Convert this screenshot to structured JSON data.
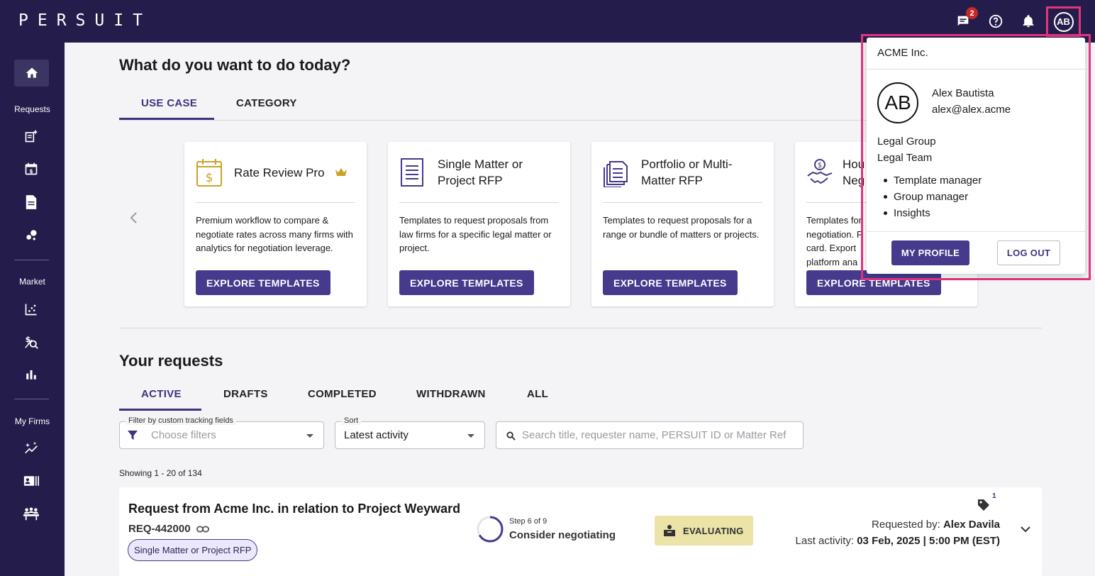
{
  "app": {
    "logo": "PERSUIT"
  },
  "topbar": {
    "messages_badge": "2",
    "avatar_initials": "AB"
  },
  "sidebar": {
    "section_requests": "Requests",
    "section_market": "Market",
    "section_my_firms": "My Firms"
  },
  "page": {
    "title": "What do you want to do today?",
    "tabs": [
      {
        "label": "USE CASE",
        "active": true
      },
      {
        "label": "CATEGORY",
        "active": false
      }
    ]
  },
  "cards": [
    {
      "title": "Rate Review Pro",
      "icon": "calendar-dollar-icon",
      "premium": true,
      "description": "Premium workflow to compare & negotiate rates across many firms with analytics for negotiation leverage.",
      "button": "EXPLORE TEMPLATES"
    },
    {
      "title": "Single Matter or Project RFP",
      "icon": "document-icon",
      "description": "Templates to request proposals from law firms for a specific legal matter or project.",
      "button": "EXPLORE TEMPLATES"
    },
    {
      "title": "Portfolio or Multi-Matter RFP",
      "icon": "folders-icon",
      "description": "Templates to request proposals for a range or bundle of matters or projects.",
      "button": "EXPLORE TEMPLATES"
    },
    {
      "title": "Hou Neg",
      "icon": "handshake-dollar-icon",
      "description": "Templates for negotiation. F card. Export platform ana",
      "button": "EXPLORE TEMPLATES"
    }
  ],
  "requests": {
    "title": "Your requests",
    "tabs": [
      {
        "label": "ACTIVE",
        "active": true
      },
      {
        "label": "DRAFTS",
        "active": false
      },
      {
        "label": "COMPLETED",
        "active": false
      },
      {
        "label": "WITHDRAWN",
        "active": false
      },
      {
        "label": "ALL",
        "active": false
      }
    ],
    "filter": {
      "label": "Filter by custom tracking fields",
      "placeholder": "Choose filters"
    },
    "sort": {
      "label": "Sort",
      "value": "Latest activity"
    },
    "search": {
      "placeholder": "Search title, requester name, PERSUIT ID or Matter Ref"
    },
    "showing": "Showing 1 - 20 of 134",
    "items": [
      {
        "title": "Request from Acme Inc. in relation to Project Weyward",
        "id": "REQ-442000",
        "type": "Single Matter or Project RFP",
        "step": "Step 6 of 9",
        "step_progress": 0.667,
        "step_name": "Consider negotiating",
        "status": "EVALUATING",
        "tag_count": "1",
        "requested_by_label": "Requested by:",
        "requested_by": "Alex Davila",
        "last_activity_label": "Last activity:",
        "last_activity": "03 Feb, 2025 | 5:00 PM (EST)"
      }
    ]
  },
  "profile_menu": {
    "org": "ACME Inc.",
    "initials": "AB",
    "name": "Alex Bautista",
    "email": "alex@alex.acme",
    "group": "Legal Group",
    "team": "Legal Team",
    "roles": [
      "Template manager",
      "Group manager",
      "Insights"
    ],
    "my_profile": "MY PROFILE",
    "log_out": "LOG OUT"
  },
  "colors": {
    "nav_bg": "#241d4b",
    "accent": "#453a8c",
    "highlight": "#e2357f",
    "status_evaluating": "#ebe3a8",
    "premium_gold": "#c9a227"
  }
}
